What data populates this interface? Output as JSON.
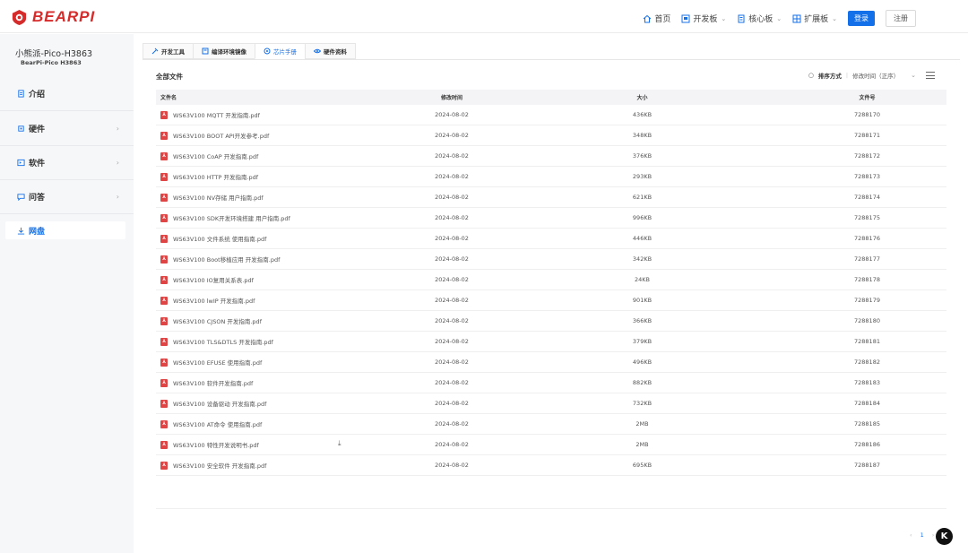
{
  "brand": {
    "name": "BEARPI",
    "color": "#d52b2b"
  },
  "accent": "#1470e8",
  "nav": {
    "items": [
      {
        "label": "首页",
        "icon": "home-icon",
        "caret": false
      },
      {
        "label": "开发板",
        "icon": "board-icon",
        "caret": true
      },
      {
        "label": "核心板",
        "icon": "chip-icon",
        "caret": true
      },
      {
        "label": "扩展板",
        "icon": "extension-icon",
        "caret": true
      }
    ],
    "login": "登录",
    "register": "注册"
  },
  "sidebar": {
    "title": "小熊派-Pico-H3863",
    "subtitle": "BearPi-Pico H3863",
    "items": [
      {
        "label": "介绍",
        "icon": "doc-icon",
        "chevron": ""
      },
      {
        "label": "硬件",
        "icon": "chip-icon",
        "chevron": "›"
      },
      {
        "label": "软件",
        "icon": "code-icon",
        "chevron": "›"
      },
      {
        "label": "问答",
        "icon": "chat-icon",
        "chevron": "›"
      }
    ],
    "active": {
      "label": "网盘",
      "icon": "download-icon"
    }
  },
  "tabs": [
    {
      "label": "开发工具",
      "icon": "tool-icon",
      "active": false
    },
    {
      "label": "编译环境镜像",
      "icon": "image-icon",
      "active": false
    },
    {
      "label": "芯片手册",
      "icon": "manual-icon",
      "active": true
    },
    {
      "label": "硬件资料",
      "icon": "eye-icon",
      "active": false
    }
  ],
  "files_title": "全部文件",
  "toolbar": {
    "sort_label": "排序方式",
    "sort_value": "修改时间（正序）"
  },
  "table": {
    "headers": {
      "name": "文件名",
      "date": "修改时间",
      "size": "大小",
      "number": "文件号"
    },
    "rows": [
      {
        "name": "WS63V100 MQTT 开发指南.pdf",
        "date": "2024-08-02",
        "size": "436KB",
        "number": "7288170"
      },
      {
        "name": "WS63V100 BOOT API开发参考.pdf",
        "date": "2024-08-02",
        "size": "348KB",
        "number": "7288171"
      },
      {
        "name": "WS63V100 CoAP 开发指南.pdf",
        "date": "2024-08-02",
        "size": "376KB",
        "number": "7288172"
      },
      {
        "name": "WS63V100 HTTP 开发指南.pdf",
        "date": "2024-08-02",
        "size": "293KB",
        "number": "7288173"
      },
      {
        "name": "WS63V100 NV存储 用户指南.pdf",
        "date": "2024-08-02",
        "size": "621KB",
        "number": "7288174"
      },
      {
        "name": "WS63V100 SDK开发环境搭建 用户指南.pdf",
        "date": "2024-08-02",
        "size": "996KB",
        "number": "7288175"
      },
      {
        "name": "WS63V100 文件系统 使用指南.pdf",
        "date": "2024-08-02",
        "size": "446KB",
        "number": "7288176"
      },
      {
        "name": "WS63V100 Boot移植应用 开发指南.pdf",
        "date": "2024-08-02",
        "size": "342KB",
        "number": "7288177"
      },
      {
        "name": "WS63V100 IO复用关系表.pdf",
        "date": "2024-08-02",
        "size": "24KB",
        "number": "7288178"
      },
      {
        "name": "WS63V100 lwIP 开发指南.pdf",
        "date": "2024-08-02",
        "size": "901KB",
        "number": "7288179"
      },
      {
        "name": "WS63V100 CJSON 开发指南.pdf",
        "date": "2024-08-02",
        "size": "366KB",
        "number": "7288180"
      },
      {
        "name": "WS63V100 TLS&DTLS 开发指南.pdf",
        "date": "2024-08-02",
        "size": "379KB",
        "number": "7288181"
      },
      {
        "name": "WS63V100 EFUSE 使用指南.pdf",
        "date": "2024-08-02",
        "size": "496KB",
        "number": "7288182"
      },
      {
        "name": "WS63V100 软件开发指南.pdf",
        "date": "2024-08-02",
        "size": "882KB",
        "number": "7288183"
      },
      {
        "name": "WS63V100 设备驱动 开发指南.pdf",
        "date": "2024-08-02",
        "size": "732KB",
        "number": "7288184"
      },
      {
        "name": "WS63V100 AT命令 使用指南.pdf",
        "date": "2024-08-02",
        "size": "2MB",
        "number": "7288185"
      },
      {
        "name": "WS63V100 特性开发说明书.pdf",
        "date": "2024-08-02",
        "size": "2MB",
        "number": "7288186",
        "download": true
      },
      {
        "name": "WS63V100 安全软件 开发指南.pdf",
        "date": "2024-08-02",
        "size": "695KB",
        "number": "7288187"
      }
    ]
  },
  "pagination": {
    "prev": "‹",
    "current": "1",
    "next": "›"
  },
  "float_button": "K"
}
